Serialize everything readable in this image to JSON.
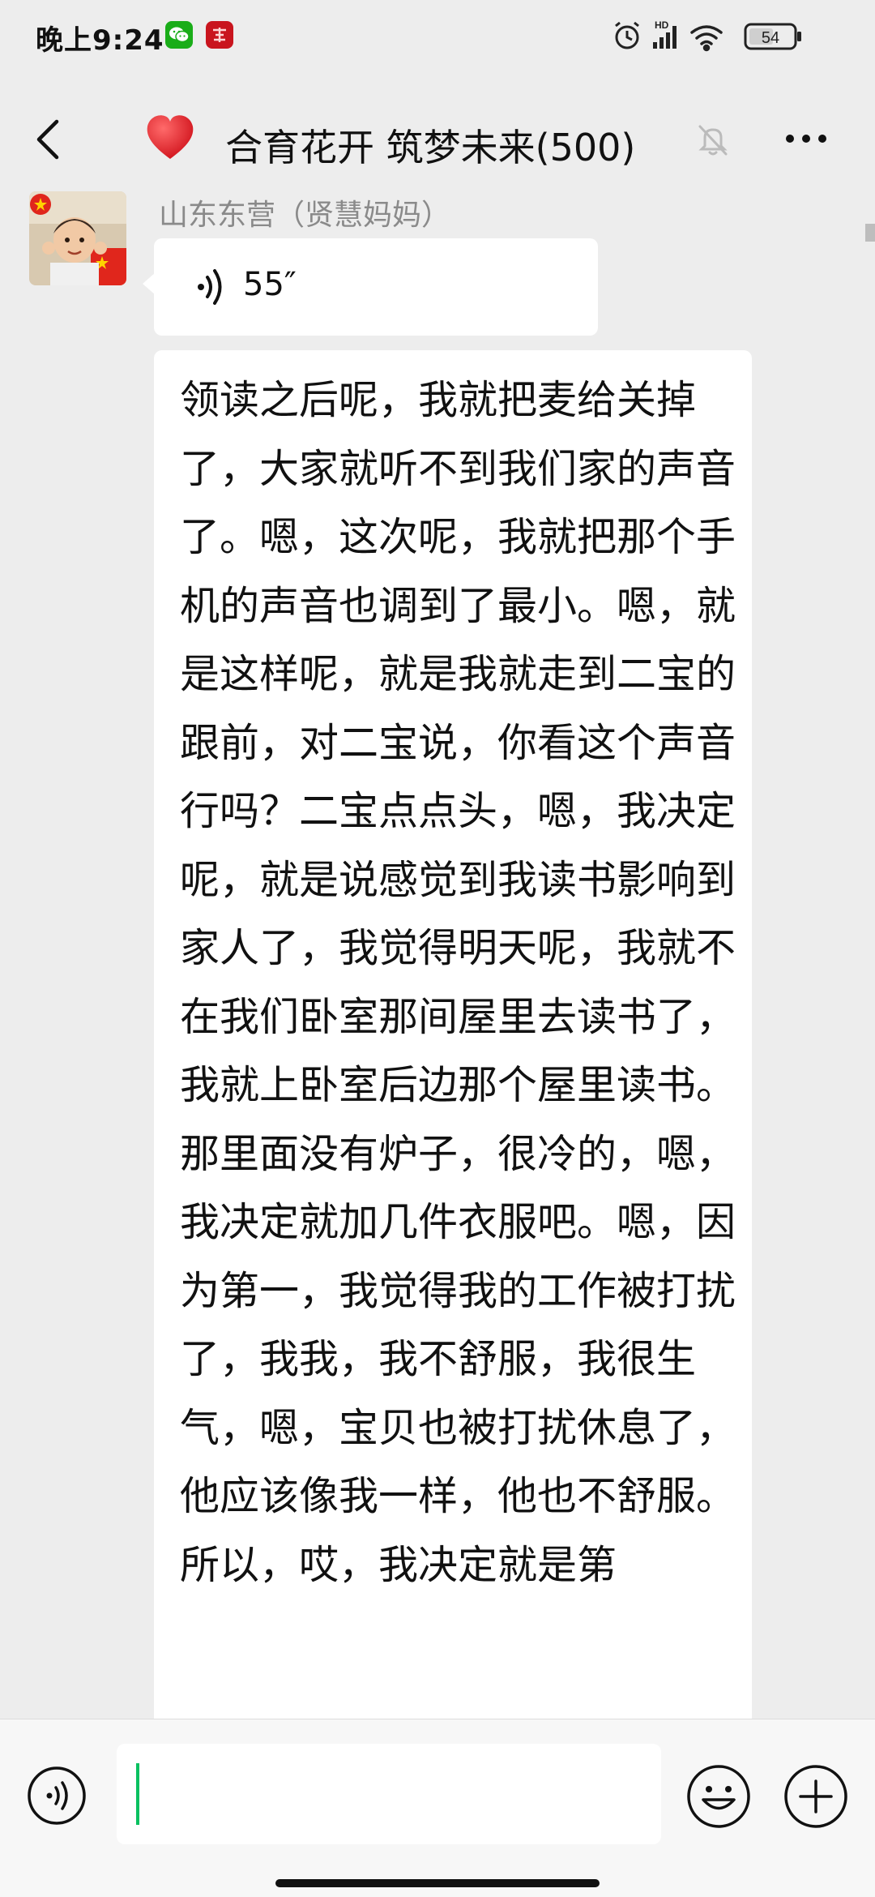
{
  "status_bar": {
    "time": "晚上9:24",
    "network_badge": "HD",
    "battery": "54",
    "app_icons": [
      "wechat-icon",
      "news-app-icon"
    ]
  },
  "header": {
    "title": "合育花开 筑梦未来(500)",
    "icons": [
      "back-arrow-icon",
      "red-heart-icon",
      "mute-bell-icon",
      "more-dots-icon"
    ]
  },
  "messages": [
    {
      "sender": "山东东营（贤慧妈妈）",
      "type": "voice",
      "duration": "55″"
    },
    {
      "type": "text",
      "content": "领读之后呢，我就把麦给关掉了，大家就听不到我们家的声音了。嗯，这次呢，我就把那个手机的声音也调到了最小。嗯，就是这样呢，就是我就走到二宝的跟前，对二宝说，你看这个声音行吗？二宝点点头，嗯，我决定呢，就是说感觉到我读书影响到家人了，我觉得明天呢，我就不在我们卧室那间屋里去读书了，我就上卧室后边那个屋里读书。那里面没有炉子，很冷的，嗯，我决定就加几件衣服吧。嗯，因为第一，我觉得我的工作被打扰了，我我，我不舒服，我很生气，嗯，宝贝也被打扰休息了，他应该像我一样，他也不舒服。所以，哎，我决定就是第"
    }
  ],
  "input_bar": {
    "placeholder": "",
    "icons": [
      "voice-input-icon",
      "emoji-icon",
      "plus-icon"
    ]
  },
  "colors": {
    "background": "#ededed",
    "bubble": "#ffffff",
    "caret": "#07c160",
    "heart": "#e8262f"
  }
}
